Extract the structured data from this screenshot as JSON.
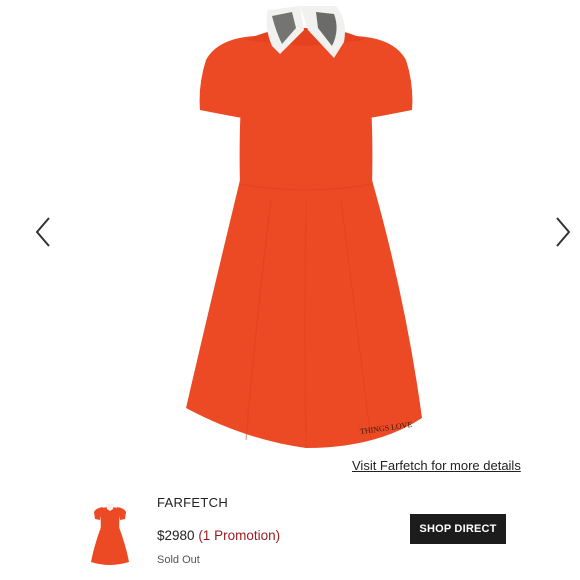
{
  "gallery": {
    "product_image": "orange-red short-sleeve fit-and-flare dress with printed white collar",
    "prev_icon": "chevron-left-icon",
    "next_icon": "chevron-right-icon",
    "dress_color": "#ec4a24",
    "collar_color": "#f1f1ef",
    "embroidery_text": "THINGS LOVE"
  },
  "details_link": "Visit Farfetch for more details",
  "offer": {
    "retailer": "FARFETCH",
    "price": "$2980",
    "promotion": "(1 Promotion)",
    "stock_status": "Sold Out",
    "button_label": "SHOP DIRECT",
    "button_color": "#1c1c1c",
    "promo_color": "#9b1c20"
  }
}
